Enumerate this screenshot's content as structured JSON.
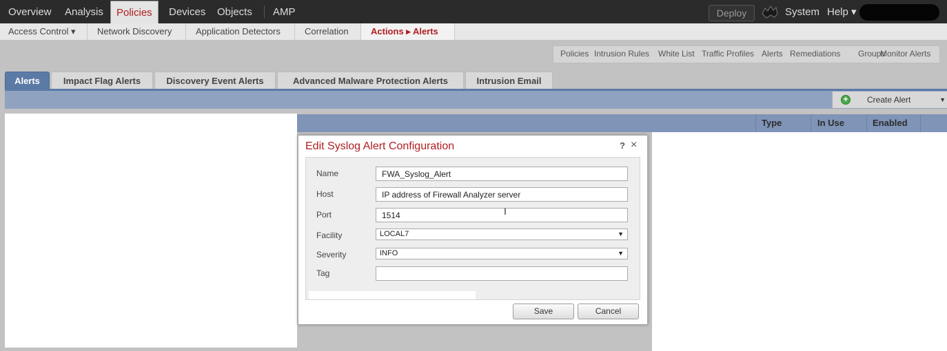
{
  "topnav": {
    "items": [
      "Overview",
      "Analysis",
      "Policies",
      "Devices",
      "Objects",
      "AMP"
    ],
    "active": "Policies",
    "deploy": "Deploy",
    "system": "System",
    "help": "Help ▾"
  },
  "subnav": {
    "items": [
      "Access Control ▾",
      "Network Discovery",
      "Application Detectors",
      "Correlation",
      "Actions ▸ Alerts"
    ],
    "active": "Actions ▸ Alerts"
  },
  "links": [
    "Policies",
    "Intrusion Rules",
    "White List",
    "Traffic Profiles",
    "Alerts",
    "Remediations",
    "Groups",
    "Monitor Alerts"
  ],
  "tabs": [
    "Alerts",
    "Impact Flag Alerts",
    "Discovery Event Alerts",
    "Advanced Malware Protection Alerts",
    "Intrusion Email"
  ],
  "active_tab": "Alerts",
  "create_alert": "Create Alert",
  "columns": [
    "Type",
    "In Use",
    "Enabled"
  ],
  "dialog": {
    "title": "Edit Syslog Alert Configuration",
    "help": "?",
    "close": "×",
    "fields": {
      "name": {
        "label": "Name",
        "value": "FWA_Syslog_Alert"
      },
      "host": {
        "label": "Host",
        "value": "IP address of Firewall Analyzer server"
      },
      "port": {
        "label": "Port",
        "value": "1514"
      },
      "facility": {
        "label": "Facility",
        "value": "LOCAL7"
      },
      "severity": {
        "label": "Severity",
        "value": "INFO"
      },
      "tag": {
        "label": "Tag",
        "value": ""
      }
    },
    "save": "Save",
    "cancel": "Cancel"
  },
  "colors": {
    "accent_red": "#b01e23",
    "tab_blue": "#5b7aa6",
    "nav_dark": "#2b2b2b"
  }
}
